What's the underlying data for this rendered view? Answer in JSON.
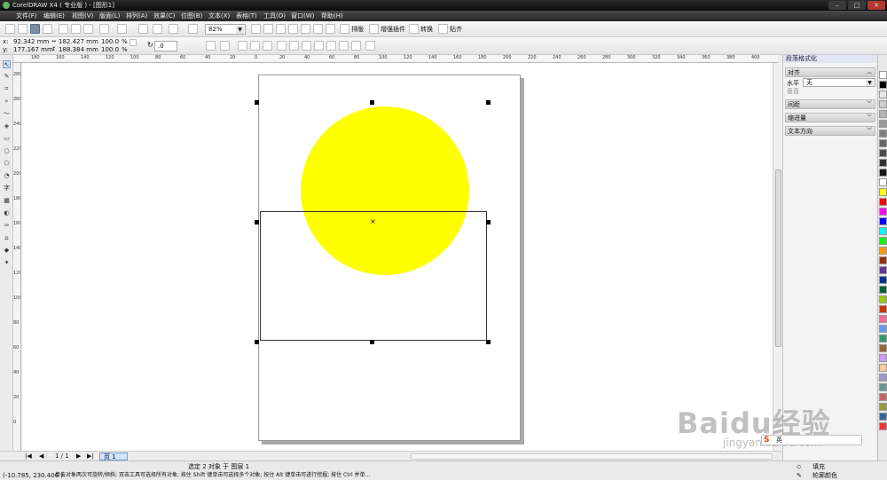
{
  "window": {
    "title": "CorelDRAW X4 ( 专业版 ) - [图形1]"
  },
  "menubar": {
    "items": [
      "文件(F)",
      "编辑(E)",
      "视图(V)",
      "版面(L)",
      "排列(A)",
      "效果(C)",
      "位图(B)",
      "文本(X)",
      "表格(T)",
      "工具(O)",
      "窗口(W)",
      "帮助(H)"
    ]
  },
  "toolbar": {
    "zoom_value": "82%",
    "tracing": [
      "排版",
      "增强插件",
      "转换",
      "贴齐"
    ]
  },
  "property_bar": {
    "x": "92.342 mm",
    "y": "177.167 mm",
    "width": "182.427 mm",
    "height": "188.384 mm",
    "scale_x": "100.0",
    "scale_y": "100.0",
    "percent": "%",
    "angle": ".0",
    "x_label": "x:",
    "y_label": "y:"
  },
  "ruler": {
    "h_labels": [
      "180",
      "160",
      "140",
      "120",
      "100",
      "80",
      "60",
      "40",
      "20",
      "0",
      "20",
      "40",
      "60",
      "80",
      "100",
      "120",
      "140",
      "160",
      "180",
      "200",
      "220",
      "240",
      "260",
      "280",
      "300",
      "320",
      "340",
      "360",
      "380",
      "400"
    ],
    "v_labels": [
      "280",
      "260",
      "240",
      "220",
      "200",
      "180",
      "160",
      "140",
      "120",
      "100",
      "80",
      "60",
      "40",
      "20",
      "0"
    ]
  },
  "docker": {
    "title": "段落格式化",
    "sections": [
      "对齐",
      "间距",
      "缩进量",
      "文本方向"
    ],
    "align_label": "水平",
    "align_value": "无",
    "vertical_label": "垂直"
  },
  "palette": {
    "colors": [
      "#ffffff",
      "#000000",
      "#e5e5e5",
      "#cccccc",
      "#b3b3b3",
      "#999999",
      "#808080",
      "#666666",
      "#4d4d4d",
      "#333333",
      "#1a1a1a",
      "#ffffff",
      "#ffff00",
      "#ff0000",
      "#ff00ff",
      "#0000ff",
      "#00ffff",
      "#00ff00",
      "#ff9900",
      "#993300",
      "#663399",
      "#003399",
      "#006633",
      "#99cc00",
      "#cc3300",
      "#ff6699",
      "#6699ff",
      "#339966",
      "#996633",
      "#cc99ff",
      "#ffcc99",
      "#9999cc",
      "#669999",
      "#cc6666",
      "#999933",
      "#336699",
      "#ff3333"
    ]
  },
  "pages": {
    "counter": "1 / 1",
    "tab": "页 1"
  },
  "status": {
    "selection": "选定 2 对象 于 图层 1",
    "coords": "(-10.785, 230.406 )",
    "hint": "单击对象两次可旋转/倾斜; 双击工具可选择所有对象; 按住 Shift 键单击可选择多个对象; 按住 Alt 键单击可进行挖掘; 按住 Ctrl 并单...",
    "fill_label": "填充",
    "outline_label": "轮廓颜色"
  },
  "watermark": {
    "text": "Baidu经验",
    "sub": "jingyan.baidu.com"
  },
  "ime": {
    "mode": "英"
  }
}
